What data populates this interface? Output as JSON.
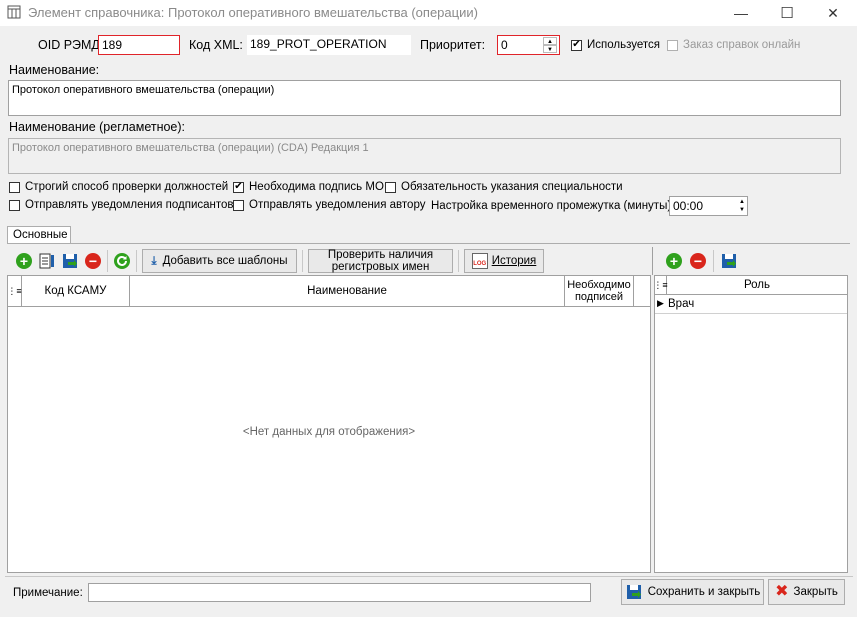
{
  "window": {
    "title": "Элемент справочника: Протокол оперативного вмешательства (операции)",
    "minimize": "—",
    "maximize": "☐",
    "close": "✕"
  },
  "form": {
    "oid_label": "OID РЭМД:",
    "oid_value": "189",
    "xml_label": "Код XML:",
    "xml_value": "189_PROT_OPERATION",
    "priority_label": "Приоритет:",
    "priority_value": "0",
    "used_label": "Используется",
    "used_checked": true,
    "online_label": "Заказ справок онлайн",
    "name_label": "Наименование:",
    "name_value": "Протокол оперативного вмешательства (операции)",
    "reg_name_label": "Наименование (регламетное):",
    "reg_name_value": "Протокол оперативного вмешательства (операции) (CDA) Редакция 1"
  },
  "options": {
    "strict_check": "Строгий способ проверки должностей",
    "need_sign_mo": "Необходима подпись МО",
    "specialty_required": "Обязательность указания специальности",
    "notify_signers": "Отправлять уведомления подписантов",
    "notify_author": "Отправлять уведомления автору",
    "time_interval_label": "Настройка временного промежутка (минуты):",
    "time_interval_value": "00:00"
  },
  "tabs": {
    "main": "Основные"
  },
  "toolbar": {
    "add_all_templates": "Добавить все шаблоны",
    "check_reg_names": "Проверить наличия регистровых имен",
    "history": "История",
    "log_badge": "LOG"
  },
  "left_grid": {
    "col_code": "Код КСАМУ",
    "col_name": "Наименование",
    "col_signs": "Необходимо подписей",
    "empty_text": "<Нет данных для отображения>"
  },
  "right_grid": {
    "col_role": "Роль",
    "rows": [
      "Врач"
    ]
  },
  "footer": {
    "note_label": "Примечание:",
    "note_value": "",
    "save_close": "Сохранить и закрыть",
    "close": "Закрыть"
  },
  "colors": {
    "accent_red": "#e0242a",
    "add_green": "#2fa11d",
    "delete_red": "#d9261c",
    "save_blue": "#1f5faa"
  }
}
